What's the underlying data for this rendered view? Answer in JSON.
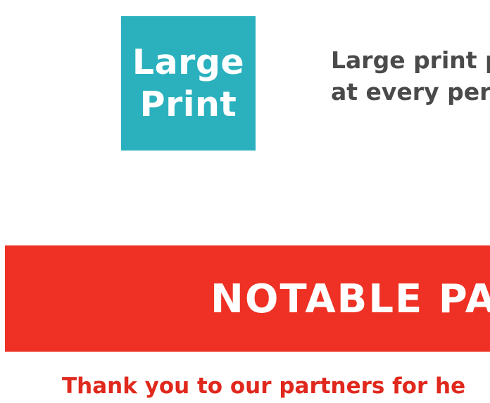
{
  "large_print_badge": {
    "line1": "Large",
    "line2": "Print"
  },
  "large_print_info": {
    "line1": "Large print p",
    "line2": "at every per"
  },
  "notable_banner": {
    "title": "NOTABLE PA"
  },
  "thanks_line": {
    "text": "Thank you to our partners for he"
  },
  "colors": {
    "badge_teal": "#2bb1be",
    "banner_red": "#ee3124",
    "thanks_red": "#e0281d",
    "body_gray": "#4a4a4a"
  }
}
